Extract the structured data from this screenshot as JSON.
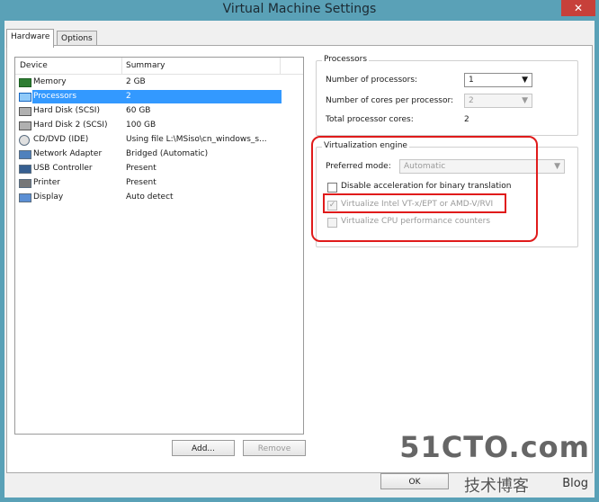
{
  "window": {
    "title": "Virtual Machine Settings",
    "close_glyph": "✕"
  },
  "tabs": [
    {
      "label": "Hardware"
    },
    {
      "label": "Options"
    }
  ],
  "device_list": {
    "col_device": "Device",
    "col_summary": "Summary",
    "rows": [
      {
        "name": "Memory",
        "summary": "2 GB",
        "icon": "memory-icon"
      },
      {
        "name": "Processors",
        "summary": "2",
        "icon": "processor-icon",
        "selected": true
      },
      {
        "name": "Hard Disk (SCSI)",
        "summary": "60 GB",
        "icon": "hard-disk-icon"
      },
      {
        "name": "Hard Disk 2 (SCSI)",
        "summary": "100 GB",
        "icon": "hard-disk-icon"
      },
      {
        "name": "CD/DVD (IDE)",
        "summary": "Using file L:\\MSiso\\cn_windows_s...",
        "icon": "cd-dvd-icon"
      },
      {
        "name": "Network Adapter",
        "summary": "Bridged (Automatic)",
        "icon": "network-adapter-icon"
      },
      {
        "name": "USB Controller",
        "summary": "Present",
        "icon": "usb-controller-icon"
      },
      {
        "name": "Printer",
        "summary": "Present",
        "icon": "printer-icon"
      },
      {
        "name": "Display",
        "summary": "Auto detect",
        "icon": "display-icon"
      }
    ]
  },
  "buttons": {
    "add": "Add...",
    "remove": "Remove",
    "ok": "OK"
  },
  "processors": {
    "legend": "Processors",
    "num_processors_label": "Number of processors:",
    "num_processors_value": "1",
    "cores_label": "Number of cores per processor:",
    "cores_value": "2",
    "total_label": "Total processor cores:",
    "total_value": "2"
  },
  "virtualization": {
    "legend": "Virtualization engine",
    "mode_label": "Preferred mode:",
    "mode_value": "Automatic",
    "disable_accel_label": "Disable acceleration for binary translation",
    "vtx_label": "Virtualize Intel VT-x/EPT or AMD-V/RVI",
    "vtx_checked": true,
    "perf_label": "Virtualize CPU performance counters"
  },
  "watermark": {
    "site": "51CTO.com",
    "subtitle": "技术博客",
    "blog": "Blog"
  },
  "colors": {
    "highlight": "#e01b1b",
    "selection": "#3399ff",
    "titlebar": "#5aa1b7"
  }
}
